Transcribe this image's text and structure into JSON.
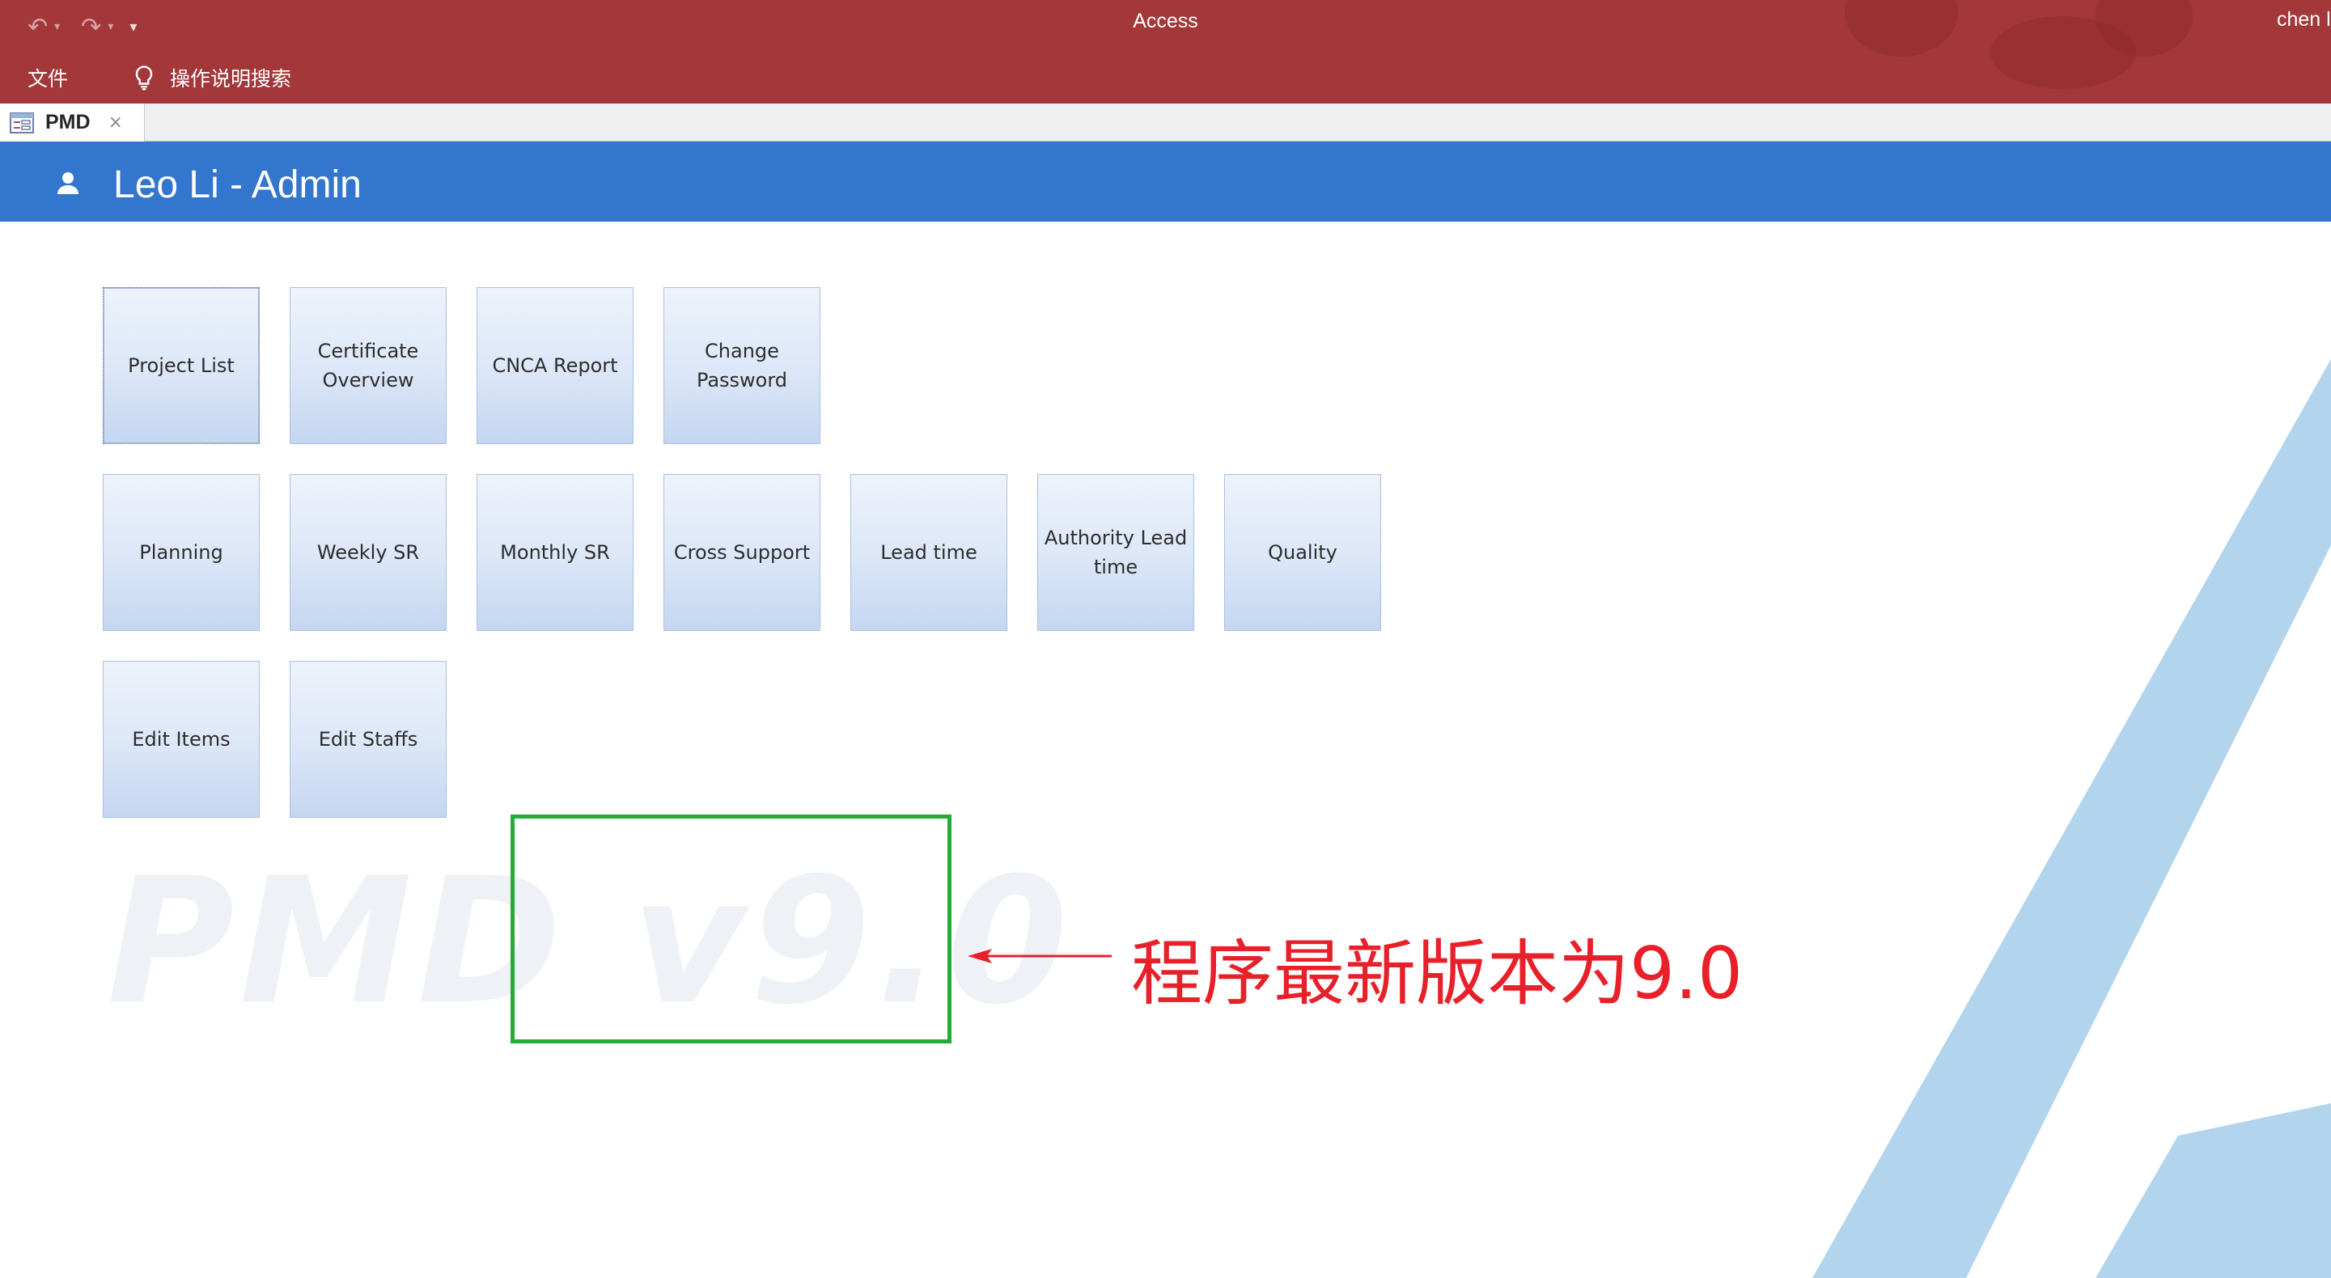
{
  "window": {
    "app_title": "Access",
    "user_name": "chen l",
    "menu": {
      "file": "文件",
      "tell_me": "操作说明搜索"
    },
    "qat": {
      "undo_icon": "undo-icon",
      "redo_icon": "redo-icon",
      "customize_icon": "customize-qat-icon"
    }
  },
  "tab": {
    "label": "PMD",
    "close": "×"
  },
  "header": {
    "title": "Leo Li - Admin"
  },
  "tiles": {
    "row1": [
      "Project List",
      "Certificate Overview",
      "CNCA Report",
      "Change Password"
    ],
    "row2": [
      "Planning",
      "Weekly SR",
      "Monthly SR",
      "Cross Support",
      "Lead time",
      "Authority Lead time",
      "Quality"
    ],
    "row3": [
      "Edit Items",
      "Edit Staffs"
    ]
  },
  "watermark": "PMD v9.0",
  "annotation": {
    "text": "程序最新版本为9.0"
  },
  "colors": {
    "titlebar": "#a4373a",
    "header": "#3376cd",
    "tile_top": "#eef3fb",
    "tile_bottom": "#c4d6f1",
    "highlight": "#22ad38",
    "annotation": "#e8202a",
    "bg_stripe": "#b2d4ec"
  }
}
